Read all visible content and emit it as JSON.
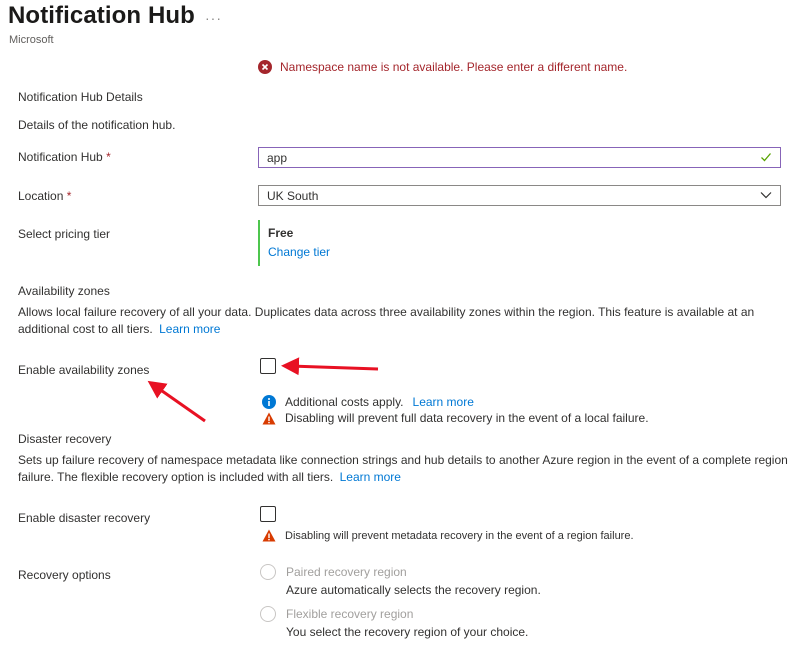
{
  "header": {
    "title": "Notification Hub",
    "more": "···",
    "subtitle": "Microsoft"
  },
  "error": {
    "message": "Namespace name is not available. Please enter a different name."
  },
  "details": {
    "heading": "Notification Hub Details",
    "description": "Details of the notification hub."
  },
  "fields": {
    "hub_label": "Notification Hub",
    "hub_value": "app",
    "location_label": "Location",
    "location_value": "UK South",
    "required_mark": "*",
    "pricing_label": "Select pricing tier",
    "tier_name": "Free",
    "tier_change": "Change tier"
  },
  "availability": {
    "heading": "Availability zones",
    "description": "Allows local failure recovery of all your data. Duplicates data across three availability zones within the region. This feature is available at an additional cost to all tiers.",
    "learn_more": "Learn more",
    "enable_label": "Enable availability zones",
    "enabled": false,
    "info_text": "Additional costs apply.",
    "info_link": "Learn more",
    "warning_text": "Disabling will prevent full data recovery in the event of a local failure."
  },
  "disaster": {
    "heading": "Disaster recovery",
    "description": "Sets up failure recovery of namespace metadata like connection strings and hub details to another Azure region in the event of a complete region failure. The flexible recovery option is included with all tiers.",
    "learn_more": "Learn more",
    "enable_label": "Enable disaster recovery",
    "enabled": false,
    "warning_text": "Disabling will prevent metadata recovery in the event of a region failure.",
    "options_label": "Recovery options",
    "options": [
      {
        "label": "Paired recovery region",
        "description": "Azure automatically selects the recovery region."
      },
      {
        "label": "Flexible recovery region",
        "description": "You select the recovery region of your choice."
      }
    ]
  },
  "colors": {
    "error": "#a4262c",
    "link": "#0078d4",
    "tier_accent": "#4ec64e",
    "warning": "#d83b01",
    "annotation_arrow": "#e81123"
  }
}
